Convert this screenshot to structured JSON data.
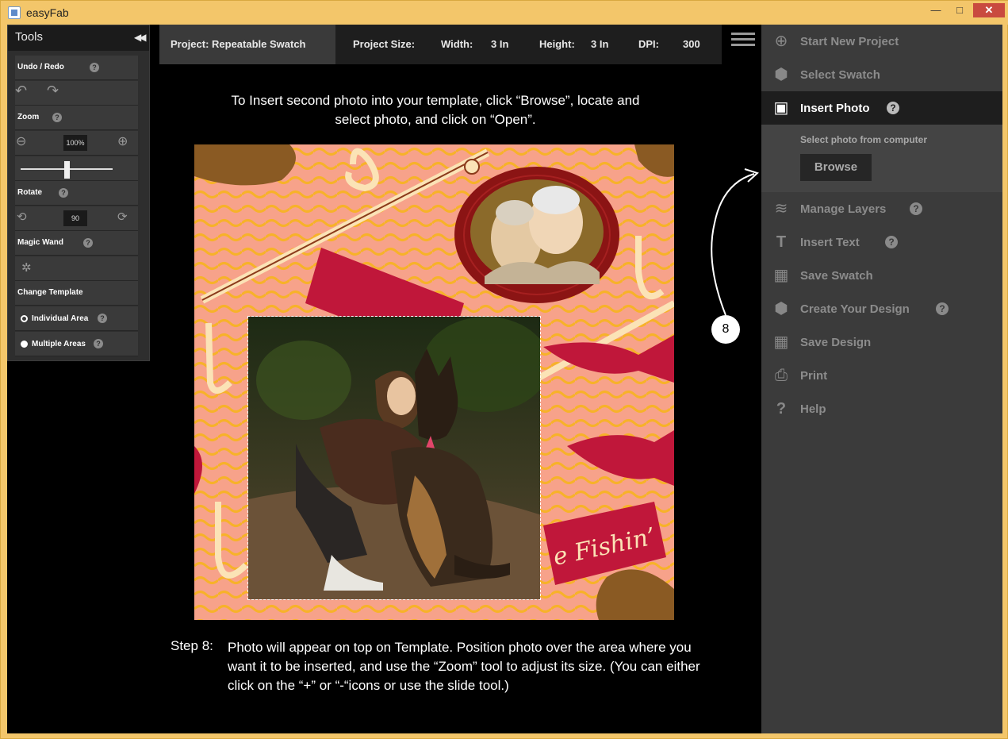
{
  "window": {
    "title": "easyFab",
    "minimize": "—",
    "maximize": "□",
    "close": "✕"
  },
  "tools": {
    "title": "Tools",
    "collapse": "◀◀",
    "undo_redo": "Undo / Redo",
    "zoom": "Zoom",
    "zoom_value": "100%",
    "zoom_slider_level": 0.5,
    "rotate": "Rotate",
    "rotate_value": "90",
    "magic_wand": "Magic Wand",
    "change_template": "Change Template",
    "individual_area": "Individual Area",
    "multiple_areas": "Multiple Areas",
    "help": "?"
  },
  "project_bar": {
    "project": "Project: Repeatable Swatch",
    "size_label": "Project Size:",
    "width_label": "Width:",
    "width_value": "3 In",
    "height_label": "Height:",
    "height_value": "3 In",
    "dpi_label": "DPI:",
    "dpi_value": "300"
  },
  "instructions": {
    "top": "To Insert second photo into your template, click “Browse”, locate and select photo, and click on “Open”.",
    "step_label": "Step 8:",
    "step_text": "Photo will appear on top on Template.  Position photo over the area where you want it to be inserted, and use the “Zoom” tool to adjust its size. (You can either click on the “+” or “-“icons or use the slide tool.)"
  },
  "canvas": {
    "banner_text": "e Fishin’"
  },
  "menu": {
    "items": [
      {
        "label": "Start New Project",
        "icon": "plus-circle-icon",
        "glyph": "⊕",
        "help": false
      },
      {
        "label": "Select Swatch",
        "icon": "hexagon-icon",
        "glyph": "⬢",
        "help": false
      },
      {
        "label": "Insert Photo",
        "icon": "image-icon",
        "glyph": "▣",
        "help": true
      },
      {
        "label": "Manage Layers",
        "icon": "layers-icon",
        "glyph": "≋",
        "help": true
      },
      {
        "label": "Insert Text",
        "icon": "text-icon",
        "glyph": "T",
        "help": true
      },
      {
        "label": "Save Swatch",
        "icon": "save-grid-icon",
        "glyph": "▦",
        "help": false
      },
      {
        "label": "Create Your Design",
        "icon": "hexagon-icon",
        "glyph": "⬢",
        "help": true
      },
      {
        "label": "Save Design",
        "icon": "save-grid-icon",
        "glyph": "▦",
        "help": false
      },
      {
        "label": "Print",
        "icon": "printer-icon",
        "glyph": "⎙",
        "help": false
      },
      {
        "label": "Help",
        "icon": "help-icon",
        "glyph": "?",
        "help": false
      }
    ],
    "insert_sub_label": "Select photo from computer",
    "browse": "Browse",
    "help": "?"
  },
  "callout": {
    "number": "8"
  },
  "colors": {
    "accent_active": "#1e1e1e",
    "panel": "#3b3b3b",
    "canvas_bg": "#f7a28a",
    "banner": "#c0173a",
    "frame": "#8b1414"
  }
}
